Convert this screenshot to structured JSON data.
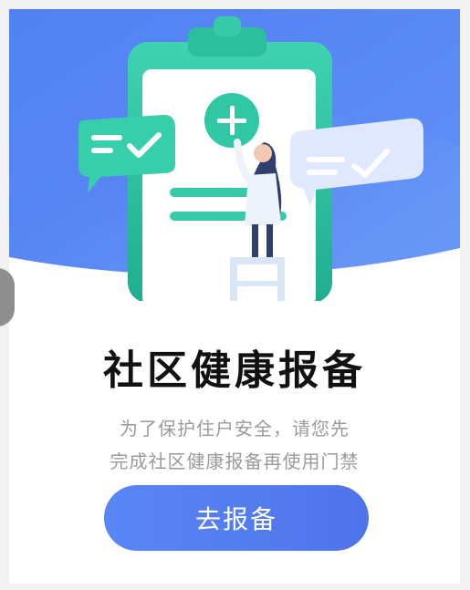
{
  "banner": {
    "illustration": "clipboard-health-report-illustration",
    "colors": {
      "sky": "#4f7ff3",
      "clipboard": "#2fc7a4",
      "bubble": "#dfe8ff"
    }
  },
  "content": {
    "title": "社区健康报备",
    "description_line1": "为了保护住户安全，请您先",
    "description_line2": "完成社区健康报备再使用门禁"
  },
  "action": {
    "button_label": "去报备",
    "color": "#5a80f0"
  }
}
